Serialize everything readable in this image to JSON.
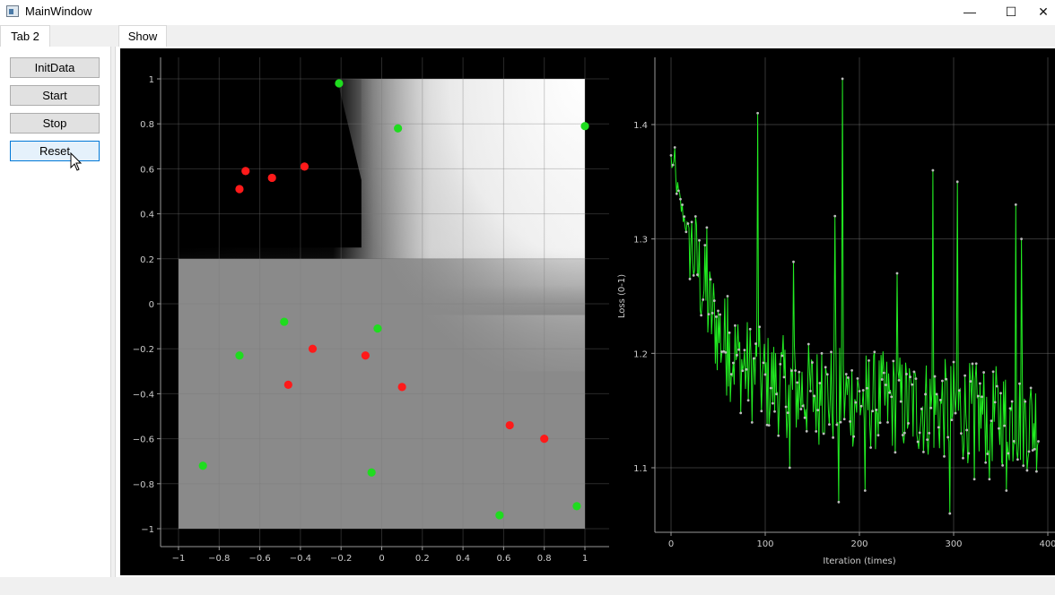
{
  "window": {
    "title": "MainWindow",
    "min_glyph": "—",
    "max_glyph": "☐",
    "close_glyph": "✕"
  },
  "left_tabs": [
    {
      "label": "Tab 2",
      "active": true
    }
  ],
  "buttons": [
    {
      "label": "InitData"
    },
    {
      "label": "Start"
    },
    {
      "label": "Stop"
    },
    {
      "label": "Reset",
      "hover": true
    }
  ],
  "right_tabs": [
    {
      "label": "Show",
      "active": true
    }
  ],
  "colors": {
    "red_class": "#ff1a1a",
    "green_class": "#1fdc1f",
    "loss_line": "#22ee22",
    "loss_marker": "#bbbbbb"
  },
  "chart_data": [
    {
      "type": "scatter",
      "title": "",
      "xlabel": "",
      "ylabel": "",
      "xlim": [
        -1,
        1
      ],
      "ylim": [
        -1,
        1
      ],
      "x_ticks": [
        "−1",
        "−0.8",
        "−0.6",
        "−0.4",
        "−0.2",
        "0",
        "0.2",
        "0.4",
        "0.6",
        "0.8",
        "1"
      ],
      "y_ticks": [
        "1",
        "0.8",
        "0.6",
        "0.4",
        "0.2",
        "0",
        "−0.2",
        "−0.4",
        "−0.6",
        "−0.8",
        "−1"
      ],
      "grid": true,
      "background": "decision-surface grayscale: black in upper-left quadrant, white in upper-right, gray in lower half",
      "series": [
        {
          "color": "red",
          "points": [
            [
              -0.67,
              0.59
            ],
            [
              -0.7,
              0.51
            ],
            [
              -0.54,
              0.56
            ],
            [
              -0.38,
              0.61
            ],
            [
              -0.34,
              -0.2
            ],
            [
              -0.46,
              -0.36
            ],
            [
              -0.08,
              -0.23
            ],
            [
              0.1,
              -0.37
            ],
            [
              0.63,
              -0.54
            ],
            [
              0.8,
              -0.6
            ]
          ]
        },
        {
          "color": "green",
          "points": [
            [
              -0.21,
              0.98
            ],
            [
              0.08,
              0.78
            ],
            [
              1.0,
              0.79
            ],
            [
              -0.48,
              -0.08
            ],
            [
              -0.02,
              -0.11
            ],
            [
              -0.7,
              -0.23
            ],
            [
              -0.88,
              -0.72
            ],
            [
              -0.05,
              -0.75
            ],
            [
              0.58,
              -0.94
            ],
            [
              0.96,
              -0.9
            ]
          ]
        }
      ]
    },
    {
      "type": "line",
      "title": "",
      "xlabel": "Iteration (times)",
      "ylabel": "Loss (0-1)",
      "xlim": [
        -10,
        400
      ],
      "ylim": [
        1.03,
        1.45
      ],
      "x_ticks": [
        "0",
        "100",
        "200",
        "300",
        "400"
      ],
      "y_ticks": [
        "1.4",
        "1.3",
        "1.2",
        "1.1"
      ],
      "grid": true,
      "series": [
        {
          "trend": [
            [
              0,
              1.37
            ],
            [
              10,
              1.33
            ],
            [
              20,
              1.3
            ],
            [
              30,
              1.27
            ],
            [
              40,
              1.24
            ],
            [
              55,
              1.21
            ],
            [
              75,
              1.19
            ],
            [
              100,
              1.175
            ],
            [
              150,
              1.165
            ],
            [
              200,
              1.16
            ],
            [
              250,
              1.155
            ],
            [
              300,
              1.15
            ],
            [
              350,
              1.145
            ],
            [
              390,
              1.14
            ]
          ],
          "spikes": [
            [
              4,
              1.38
            ],
            [
              38,
              1.31
            ],
            [
              92,
              1.41
            ],
            [
              182,
              1.44
            ],
            [
              278,
              1.36
            ],
            [
              304,
              1.35
            ],
            [
              366,
              1.33
            ],
            [
              372,
              1.3
            ],
            [
              174,
              1.32
            ],
            [
              240,
              1.27
            ],
            [
              160,
              1.2
            ],
            [
              130,
              1.28
            ],
            [
              60,
              1.25
            ],
            [
              126,
              1.1
            ],
            [
              178,
              1.07
            ],
            [
              296,
              1.06
            ],
            [
              338,
              1.09
            ],
            [
              356,
              1.08
            ],
            [
              206,
              1.08
            ],
            [
              322,
              1.09
            ]
          ]
        }
      ]
    }
  ]
}
